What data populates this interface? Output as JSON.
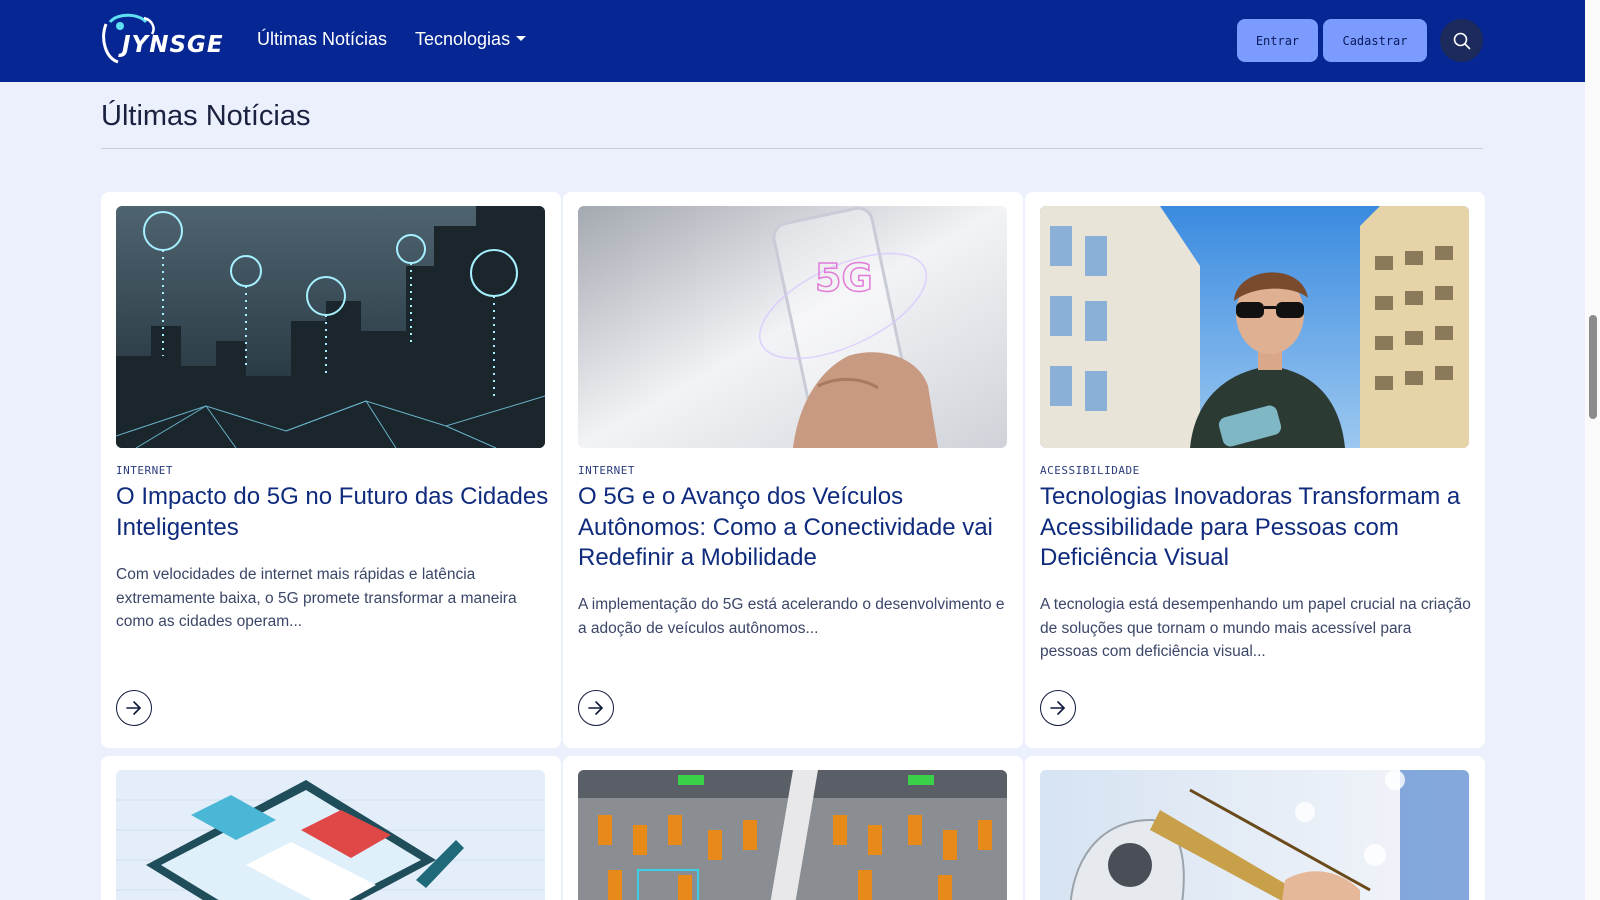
{
  "nav": {
    "brand": "JYNSGE",
    "links": [
      "Últimas Notícias",
      "Tecnologias"
    ],
    "login_label": "Entrar",
    "signup_label": "Cadastrar"
  },
  "section": {
    "title": "Últimas Notícias"
  },
  "cards": [
    {
      "category": "INTERNET",
      "title": "O Impacto do 5G no Futuro das Cidades Inteligentes",
      "excerpt": "Com velocidades de internet mais rápidas e latência extremamente baixa, o 5G promete transformar a maneira como as cidades operam..."
    },
    {
      "category": "INTERNET",
      "title": "O 5G e o Avanço dos Veículos Autônomos: Como a Conectividade vai Redefinir a Mobilidade",
      "excerpt": "A implementação do 5G está acelerando o desenvolvimento e a adoção de veículos autônomos...",
      "image_text": "5G"
    },
    {
      "category": "ACESSIBILIDADE",
      "title": "Tecnologias Inovadoras Transformam a Acessibilidade para Pessoas com Deficiência Visual",
      "excerpt": "A tecnologia está desempenhando um papel crucial na criação de soluções que tornam o mundo mais acessível para pessoas com deficiência visual..."
    }
  ],
  "colors": {
    "navbar": "#062693",
    "page_bg": "#ecf0fd",
    "button": "#7b9bfe",
    "title": "#0f2b7d"
  },
  "icons": [
    "search-icon",
    "arrow-right-circle-icon",
    "chevron-down-icon"
  ]
}
